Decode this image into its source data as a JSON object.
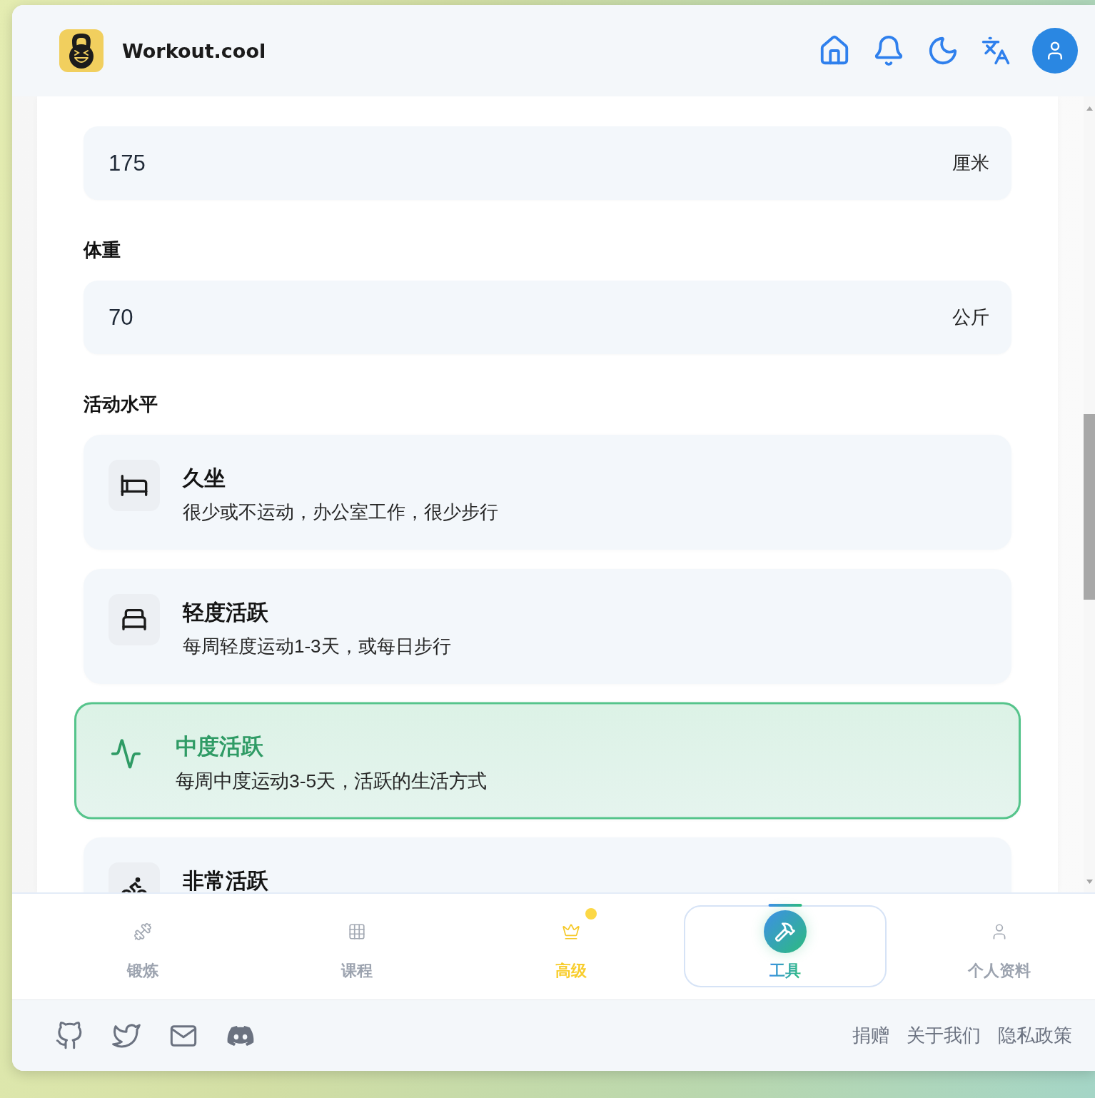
{
  "header": {
    "title": "Workout.cool"
  },
  "form": {
    "fields": [
      {
        "value": "175",
        "unit": "厘米"
      },
      {
        "label": "体重",
        "value": "70",
        "unit": "公斤"
      }
    ]
  },
  "activity": {
    "label": "活动水平",
    "options": [
      {
        "kind": "sedentary",
        "title": "久坐",
        "description": "很少或不运动，办公室工作，很少步行",
        "selected": false
      },
      {
        "kind": "light",
        "title": "轻度活跃",
        "description": "每周轻度运动1-3天，或每日步行",
        "selected": false
      },
      {
        "kind": "moderate",
        "title": "中度活跃",
        "description": "每周中度运动3-5天，活跃的生活方式",
        "selected": true
      },
      {
        "kind": "very",
        "title": "非常活跃",
        "selected": false
      }
    ]
  },
  "nav": [
    {
      "kind": "workout",
      "label": "锻炼",
      "selected": false,
      "dot": false
    },
    {
      "kind": "programs",
      "label": "课程",
      "selected": false,
      "dot": false
    },
    {
      "kind": "premium",
      "label": "高级",
      "selected": false,
      "dot": true
    },
    {
      "kind": "tools",
      "label": "工具",
      "selected": true,
      "dot": false
    },
    {
      "kind": "profile",
      "label": "个人资料",
      "selected": false,
      "dot": false
    }
  ],
  "footer": {
    "links": [
      "捐赠",
      "关于我们",
      "隐私政策"
    ]
  }
}
